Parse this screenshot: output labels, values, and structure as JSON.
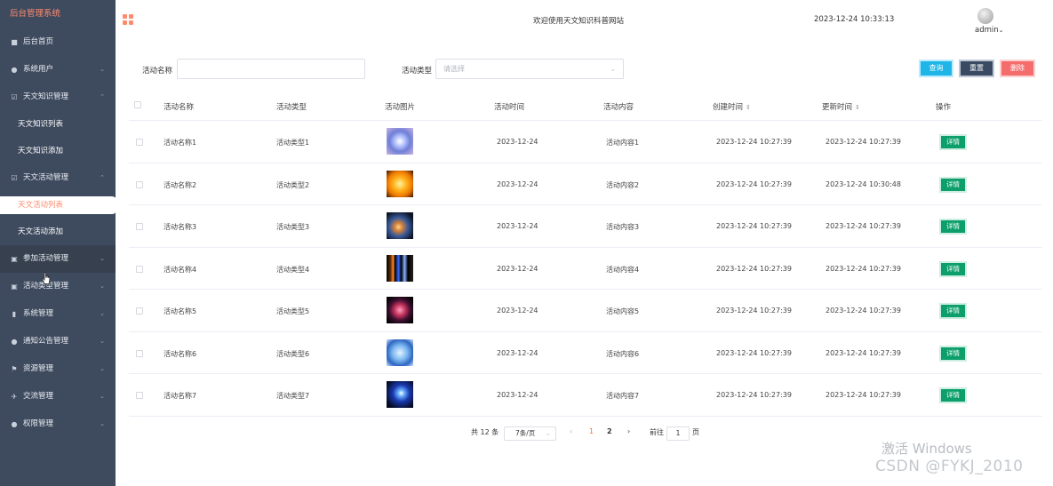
{
  "sidebar": {
    "brand": "后台管理系统",
    "items": [
      {
        "label": "后台首页",
        "icon": "■"
      },
      {
        "label": "系统用户",
        "icon": "●",
        "chevron": "⌄"
      },
      {
        "label": "天文知识管理",
        "icon": "☑",
        "chevron": "⌃"
      },
      {
        "label": "天文知识列表"
      },
      {
        "label": "天文知识添加"
      },
      {
        "label": "天文活动管理",
        "icon": "☑",
        "chevron": "⌃"
      },
      {
        "label": "天文活动列表"
      },
      {
        "label": "天文活动添加"
      },
      {
        "label": "参加活动管理",
        "icon": "▣",
        "chevron": "⌄"
      },
      {
        "label": "活动类型管理",
        "icon": "▣",
        "chevron": "⌄"
      },
      {
        "label": "系统管理",
        "icon": "▮",
        "chevron": "⌄"
      },
      {
        "label": "通知公告管理",
        "icon": "●",
        "chevron": "⌄"
      },
      {
        "label": "资源管理",
        "icon": "⚑",
        "chevron": "⌄"
      },
      {
        "label": "交流管理",
        "icon": "✈",
        "chevron": "⌄"
      },
      {
        "label": "权限管理",
        "icon": "●",
        "chevron": "⌄"
      }
    ]
  },
  "header": {
    "title": "欢迎使用天文知识科普网站",
    "datetime": "2023-12-24 10:33:13",
    "user": "admin",
    "user_chevron": "⌄"
  },
  "search": {
    "name_label": "活动名称",
    "name_value": "",
    "type_label": "活动类型",
    "type_placeholder": "请选择",
    "query_button": "查询",
    "reset_button": "重置",
    "delete_button": "删除"
  },
  "table": {
    "headers": [
      "活动名称",
      "活动类型",
      "活动图片",
      "活动时间",
      "活动内容",
      "创建时间",
      "更新时间",
      "操作"
    ],
    "sort_glyph": "⇕",
    "detail_label": "详情",
    "rows": [
      {
        "name": "活动名称1",
        "type": "活动类型1",
        "date": "2023-12-24",
        "content": "活动内容1",
        "created": "2023-12-24 10:27:39",
        "updated": "2023-12-24 10:27:39",
        "image": "blue-star"
      },
      {
        "name": "活动名称2",
        "type": "活动类型2",
        "date": "2023-12-24",
        "content": "活动内容2",
        "created": "2023-12-24 10:27:39",
        "updated": "2023-12-24 10:30:48",
        "image": "sun"
      },
      {
        "name": "活动名称3",
        "type": "活动类型3",
        "date": "2023-12-24",
        "content": "活动内容3",
        "created": "2023-12-24 10:27:39",
        "updated": "2023-12-24 10:27:39",
        "image": "nebula"
      },
      {
        "name": "活动名称4",
        "type": "活动类型4",
        "date": "2023-12-24",
        "content": "活动内容4",
        "created": "2023-12-24 10:27:39",
        "updated": "2023-12-24 10:27:39",
        "image": "spectrum"
      },
      {
        "name": "活动名称5",
        "type": "活动类型5",
        "date": "2023-12-24",
        "content": "活动内容5",
        "created": "2023-12-24 10:27:39",
        "updated": "2023-12-24 10:27:39",
        "image": "red-nebula"
      },
      {
        "name": "活动名称6",
        "type": "活动类型6",
        "date": "2023-12-24",
        "content": "活动内容6",
        "created": "2023-12-24 10:27:39",
        "updated": "2023-12-24 10:27:39",
        "image": "blue-sphere"
      },
      {
        "name": "活动名称7",
        "type": "活动类型7",
        "date": "2023-12-24",
        "content": "活动内容7",
        "created": "2023-12-24 10:27:39",
        "updated": "2023-12-24 10:27:39",
        "image": "galaxy"
      }
    ]
  },
  "pagination": {
    "total": "共 12 条",
    "page_size": "7条/页",
    "prev": "‹",
    "pages": [
      "1",
      "2"
    ],
    "current": "1",
    "next": "›",
    "goto_prefix": "前往",
    "goto_value": "1",
    "goto_suffix": "页"
  },
  "watermark": {
    "activate": "激活 Windows",
    "credit": "CSDN @FYKJ_2010"
  },
  "colors": {
    "sidebar_bg": "#3e4a5e",
    "accent": "#ff8b6e",
    "query": "#1fb5e6",
    "reset": "#3a4a63",
    "delete": "#f56c6c",
    "detail": "#0d9f6b"
  }
}
